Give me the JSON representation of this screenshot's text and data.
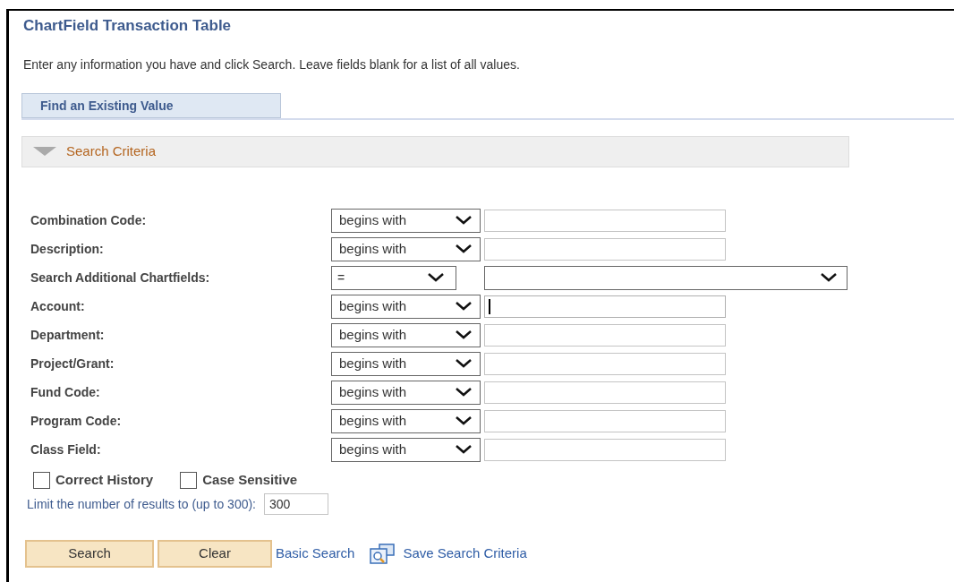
{
  "title": "ChartField Transaction Table",
  "instructions": "Enter any information you have and click Search. Leave fields blank for a list of all values.",
  "tabs": [
    {
      "label": "Find an Existing Value",
      "selected": true
    }
  ],
  "section": {
    "label": "Search Criteria",
    "expanded": true
  },
  "criteria": [
    {
      "kind": "text",
      "label": "Combination Code:",
      "operator": "begins with",
      "focused": false
    },
    {
      "kind": "text",
      "label": "Description:",
      "operator": "begins with",
      "focused": false
    },
    {
      "kind": "dropdown",
      "label": "Search Additional Chartfields:",
      "operator": "="
    },
    {
      "kind": "text",
      "label": "Account:",
      "operator": "begins with",
      "focused": true
    },
    {
      "kind": "text",
      "label": "Department:",
      "operator": "begins with",
      "focused": false
    },
    {
      "kind": "text",
      "label": "Project/Grant:",
      "operator": "begins with",
      "focused": false
    },
    {
      "kind": "text",
      "label": "Fund Code:",
      "operator": "begins with",
      "focused": false
    },
    {
      "kind": "text",
      "label": "Program Code:",
      "operator": "begins with",
      "focused": false
    },
    {
      "kind": "text",
      "label": "Class Field:",
      "operator": "begins with",
      "focused": false
    }
  ],
  "checkboxes": [
    {
      "label": "Correct History",
      "checked": false
    },
    {
      "label": "Case Sensitive",
      "checked": false
    }
  ],
  "limit": {
    "label": "Limit the number of results to (up to 300):",
    "value": "300"
  },
  "buttons": [
    "Search",
    "Clear"
  ],
  "links": [
    {
      "kind": "plain",
      "label": "Basic Search"
    },
    {
      "kind": "icon",
      "label": "Save Search Criteria"
    }
  ]
}
